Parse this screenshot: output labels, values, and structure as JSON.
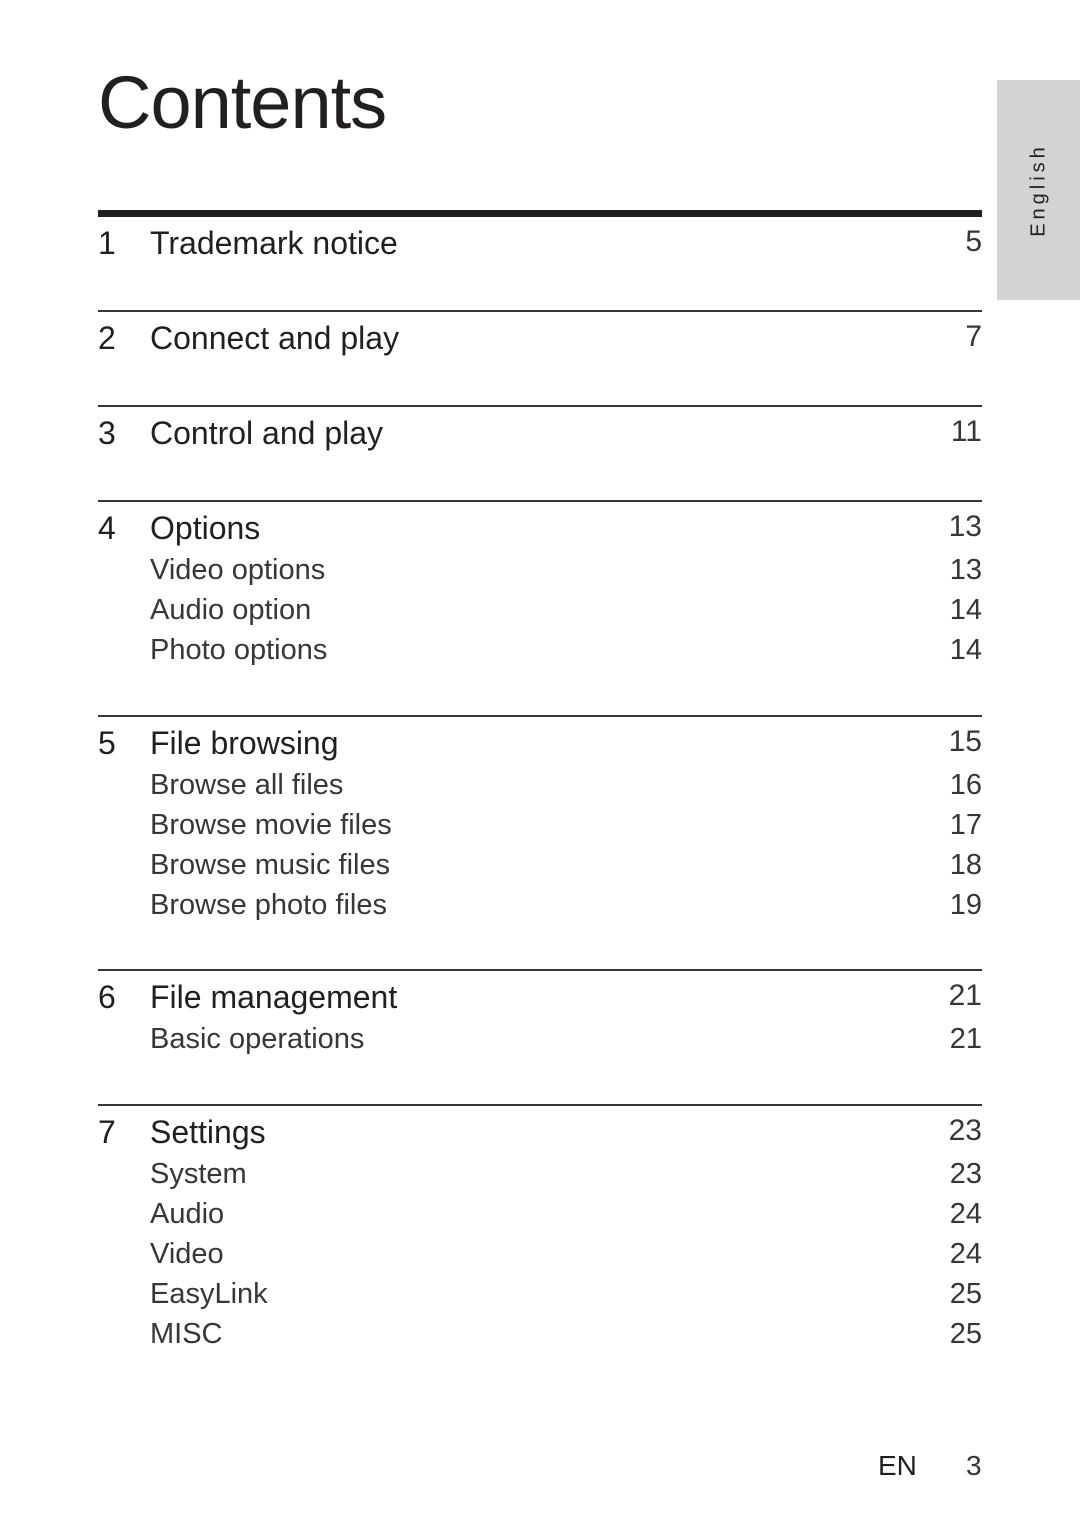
{
  "title": "Contents",
  "language_tab": "English",
  "sections": [
    {
      "number": "1",
      "title": "Trademark notice",
      "page": "5",
      "items": []
    },
    {
      "number": "2",
      "title": "Connect and play",
      "page": "7",
      "items": []
    },
    {
      "number": "3",
      "title": "Control and play",
      "page": "11",
      "items": []
    },
    {
      "number": "4",
      "title": "Options",
      "page": "13",
      "items": [
        {
          "title": "Video options",
          "page": "13"
        },
        {
          "title": "Audio option",
          "page": "14"
        },
        {
          "title": "Photo options",
          "page": "14"
        }
      ]
    },
    {
      "number": "5",
      "title": "File browsing",
      "page": "15",
      "items": [
        {
          "title": "Browse all files",
          "page": "16"
        },
        {
          "title": "Browse movie files",
          "page": "17"
        },
        {
          "title": "Browse music files",
          "page": "18"
        },
        {
          "title": "Browse photo files",
          "page": "19"
        }
      ]
    },
    {
      "number": "6",
      "title": "File management",
      "page": "21",
      "items": [
        {
          "title": "Basic operations",
          "page": "21"
        }
      ]
    },
    {
      "number": "7",
      "title": "Settings",
      "page": "23",
      "items": [
        {
          "title": "System",
          "page": "23"
        },
        {
          "title": "Audio",
          "page": "24"
        },
        {
          "title": "Video",
          "page": "24"
        },
        {
          "title": "EasyLink",
          "page": "25"
        },
        {
          "title": "MISC",
          "page": "25"
        }
      ]
    }
  ],
  "footer": {
    "language_code": "EN",
    "page_number": "3"
  }
}
